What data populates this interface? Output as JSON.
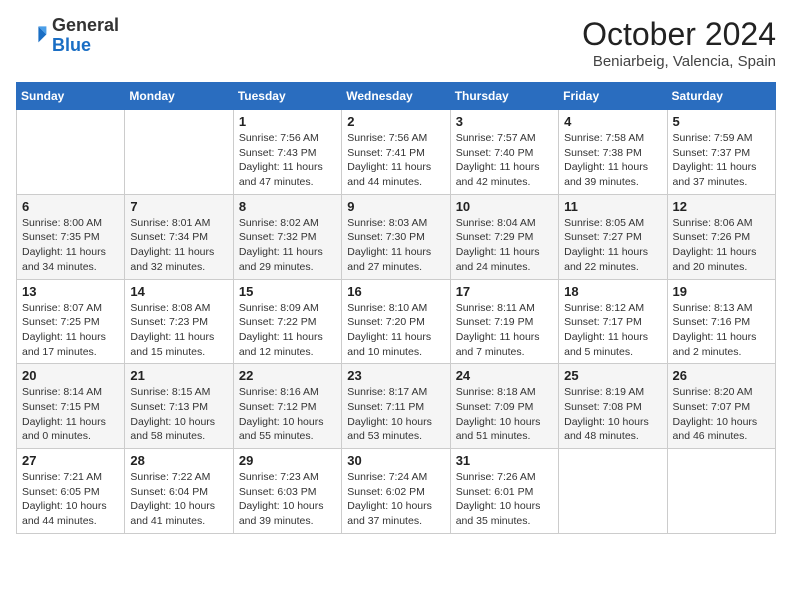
{
  "header": {
    "logo": {
      "general": "General",
      "blue": "Blue"
    },
    "title": "October 2024",
    "subtitle": "Beniarbeig, Valencia, Spain"
  },
  "weekdays": [
    "Sunday",
    "Monday",
    "Tuesday",
    "Wednesday",
    "Thursday",
    "Friday",
    "Saturday"
  ],
  "weeks": [
    [
      {
        "day": "",
        "info": ""
      },
      {
        "day": "",
        "info": ""
      },
      {
        "day": "1",
        "info": "Sunrise: 7:56 AM\nSunset: 7:43 PM\nDaylight: 11 hours and 47 minutes."
      },
      {
        "day": "2",
        "info": "Sunrise: 7:56 AM\nSunset: 7:41 PM\nDaylight: 11 hours and 44 minutes."
      },
      {
        "day": "3",
        "info": "Sunrise: 7:57 AM\nSunset: 7:40 PM\nDaylight: 11 hours and 42 minutes."
      },
      {
        "day": "4",
        "info": "Sunrise: 7:58 AM\nSunset: 7:38 PM\nDaylight: 11 hours and 39 minutes."
      },
      {
        "day": "5",
        "info": "Sunrise: 7:59 AM\nSunset: 7:37 PM\nDaylight: 11 hours and 37 minutes."
      }
    ],
    [
      {
        "day": "6",
        "info": "Sunrise: 8:00 AM\nSunset: 7:35 PM\nDaylight: 11 hours and 34 minutes."
      },
      {
        "day": "7",
        "info": "Sunrise: 8:01 AM\nSunset: 7:34 PM\nDaylight: 11 hours and 32 minutes."
      },
      {
        "day": "8",
        "info": "Sunrise: 8:02 AM\nSunset: 7:32 PM\nDaylight: 11 hours and 29 minutes."
      },
      {
        "day": "9",
        "info": "Sunrise: 8:03 AM\nSunset: 7:30 PM\nDaylight: 11 hours and 27 minutes."
      },
      {
        "day": "10",
        "info": "Sunrise: 8:04 AM\nSunset: 7:29 PM\nDaylight: 11 hours and 24 minutes."
      },
      {
        "day": "11",
        "info": "Sunrise: 8:05 AM\nSunset: 7:27 PM\nDaylight: 11 hours and 22 minutes."
      },
      {
        "day": "12",
        "info": "Sunrise: 8:06 AM\nSunset: 7:26 PM\nDaylight: 11 hours and 20 minutes."
      }
    ],
    [
      {
        "day": "13",
        "info": "Sunrise: 8:07 AM\nSunset: 7:25 PM\nDaylight: 11 hours and 17 minutes."
      },
      {
        "day": "14",
        "info": "Sunrise: 8:08 AM\nSunset: 7:23 PM\nDaylight: 11 hours and 15 minutes."
      },
      {
        "day": "15",
        "info": "Sunrise: 8:09 AM\nSunset: 7:22 PM\nDaylight: 11 hours and 12 minutes."
      },
      {
        "day": "16",
        "info": "Sunrise: 8:10 AM\nSunset: 7:20 PM\nDaylight: 11 hours and 10 minutes."
      },
      {
        "day": "17",
        "info": "Sunrise: 8:11 AM\nSunset: 7:19 PM\nDaylight: 11 hours and 7 minutes."
      },
      {
        "day": "18",
        "info": "Sunrise: 8:12 AM\nSunset: 7:17 PM\nDaylight: 11 hours and 5 minutes."
      },
      {
        "day": "19",
        "info": "Sunrise: 8:13 AM\nSunset: 7:16 PM\nDaylight: 11 hours and 2 minutes."
      }
    ],
    [
      {
        "day": "20",
        "info": "Sunrise: 8:14 AM\nSunset: 7:15 PM\nDaylight: 11 hours and 0 minutes."
      },
      {
        "day": "21",
        "info": "Sunrise: 8:15 AM\nSunset: 7:13 PM\nDaylight: 10 hours and 58 minutes."
      },
      {
        "day": "22",
        "info": "Sunrise: 8:16 AM\nSunset: 7:12 PM\nDaylight: 10 hours and 55 minutes."
      },
      {
        "day": "23",
        "info": "Sunrise: 8:17 AM\nSunset: 7:11 PM\nDaylight: 10 hours and 53 minutes."
      },
      {
        "day": "24",
        "info": "Sunrise: 8:18 AM\nSunset: 7:09 PM\nDaylight: 10 hours and 51 minutes."
      },
      {
        "day": "25",
        "info": "Sunrise: 8:19 AM\nSunset: 7:08 PM\nDaylight: 10 hours and 48 minutes."
      },
      {
        "day": "26",
        "info": "Sunrise: 8:20 AM\nSunset: 7:07 PM\nDaylight: 10 hours and 46 minutes."
      }
    ],
    [
      {
        "day": "27",
        "info": "Sunrise: 7:21 AM\nSunset: 6:05 PM\nDaylight: 10 hours and 44 minutes."
      },
      {
        "day": "28",
        "info": "Sunrise: 7:22 AM\nSunset: 6:04 PM\nDaylight: 10 hours and 41 minutes."
      },
      {
        "day": "29",
        "info": "Sunrise: 7:23 AM\nSunset: 6:03 PM\nDaylight: 10 hours and 39 minutes."
      },
      {
        "day": "30",
        "info": "Sunrise: 7:24 AM\nSunset: 6:02 PM\nDaylight: 10 hours and 37 minutes."
      },
      {
        "day": "31",
        "info": "Sunrise: 7:26 AM\nSunset: 6:01 PM\nDaylight: 10 hours and 35 minutes."
      },
      {
        "day": "",
        "info": ""
      },
      {
        "day": "",
        "info": ""
      }
    ]
  ]
}
